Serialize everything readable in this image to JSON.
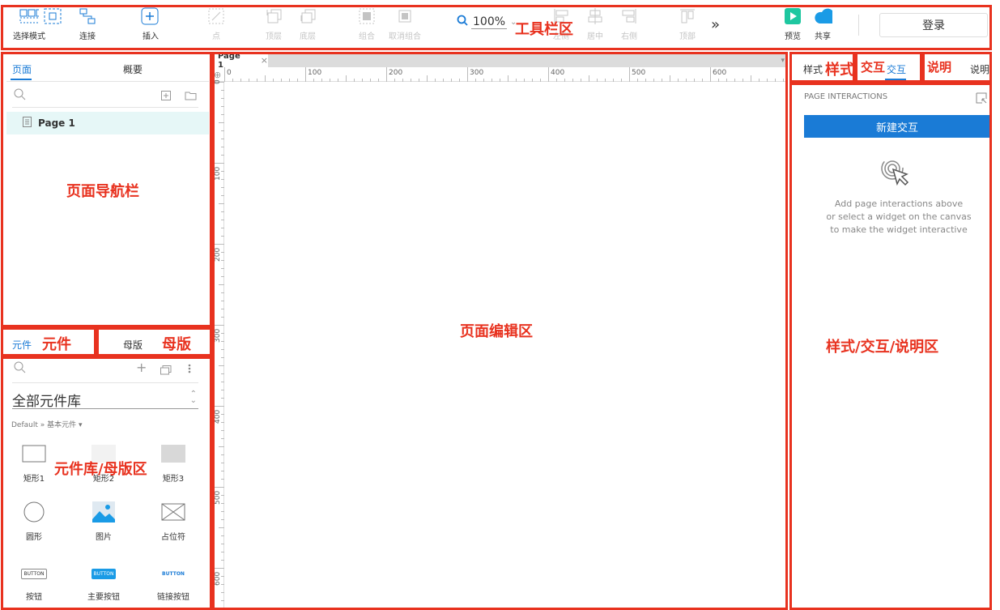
{
  "toolbar": {
    "items": [
      {
        "label": "选择模式"
      },
      {
        "label": "连接"
      },
      {
        "label": "插入"
      },
      {
        "label": "点"
      },
      {
        "label": "顶层"
      },
      {
        "label": "底层"
      },
      {
        "label": "组合"
      },
      {
        "label": "取消组合"
      },
      {
        "label": "左侧"
      },
      {
        "label": "居中"
      },
      {
        "label": "右侧"
      },
      {
        "label": "顶部"
      },
      {
        "label": "预览"
      },
      {
        "label": "共享"
      }
    ],
    "zoom": "100%",
    "overflow_glyph": "»",
    "login": "登录"
  },
  "left": {
    "tabs": {
      "pages": "页面",
      "outline": "概要"
    },
    "page_name": "Page 1",
    "lib_tabs": {
      "widgets": "元件",
      "masters": "母版"
    },
    "library_select": "全部元件库",
    "library_path": "Default » 基本元件",
    "widgets": [
      {
        "label": "矩形1"
      },
      {
        "label": "矩形2"
      },
      {
        "label": "矩形3"
      },
      {
        "label": "圆形"
      },
      {
        "label": "图片"
      },
      {
        "label": "占位符"
      },
      {
        "label": "按钮",
        "text": "BUTTON"
      },
      {
        "label": "主要按钮",
        "text": "BUTTON"
      },
      {
        "label": "链接按钮",
        "text": "BUTTON"
      }
    ]
  },
  "canvas": {
    "tab": "Page 1",
    "h_ticks": [
      "0",
      "100",
      "200",
      "300",
      "400",
      "500",
      "600"
    ],
    "v_ticks": [
      "0",
      "100",
      "200",
      "300",
      "400",
      "500",
      "600"
    ]
  },
  "right": {
    "tabs": {
      "style": "样式",
      "interact": "交互",
      "notes": "说明"
    },
    "section_title": "PAGE INTERACTIONS",
    "new_button": "新建交互",
    "hint_lines": [
      "Add page interactions above",
      "or select a widget on the canvas",
      "to make the widget interactive"
    ]
  },
  "annotations": {
    "toolbar": "工具栏区",
    "pages": "页面导航栏",
    "widgets": "元件",
    "masters": "母版",
    "library": "元件库/母版区",
    "canvas": "页面编辑区",
    "style": "样式",
    "interact": "交互",
    "notes": "说明",
    "right": "样式/交互/说明区"
  },
  "colors": {
    "accent": "#1a7bd6",
    "annotation": "#e8321f",
    "page_highlight": "#e6f7f7",
    "preview": "#1ec7a0"
  }
}
